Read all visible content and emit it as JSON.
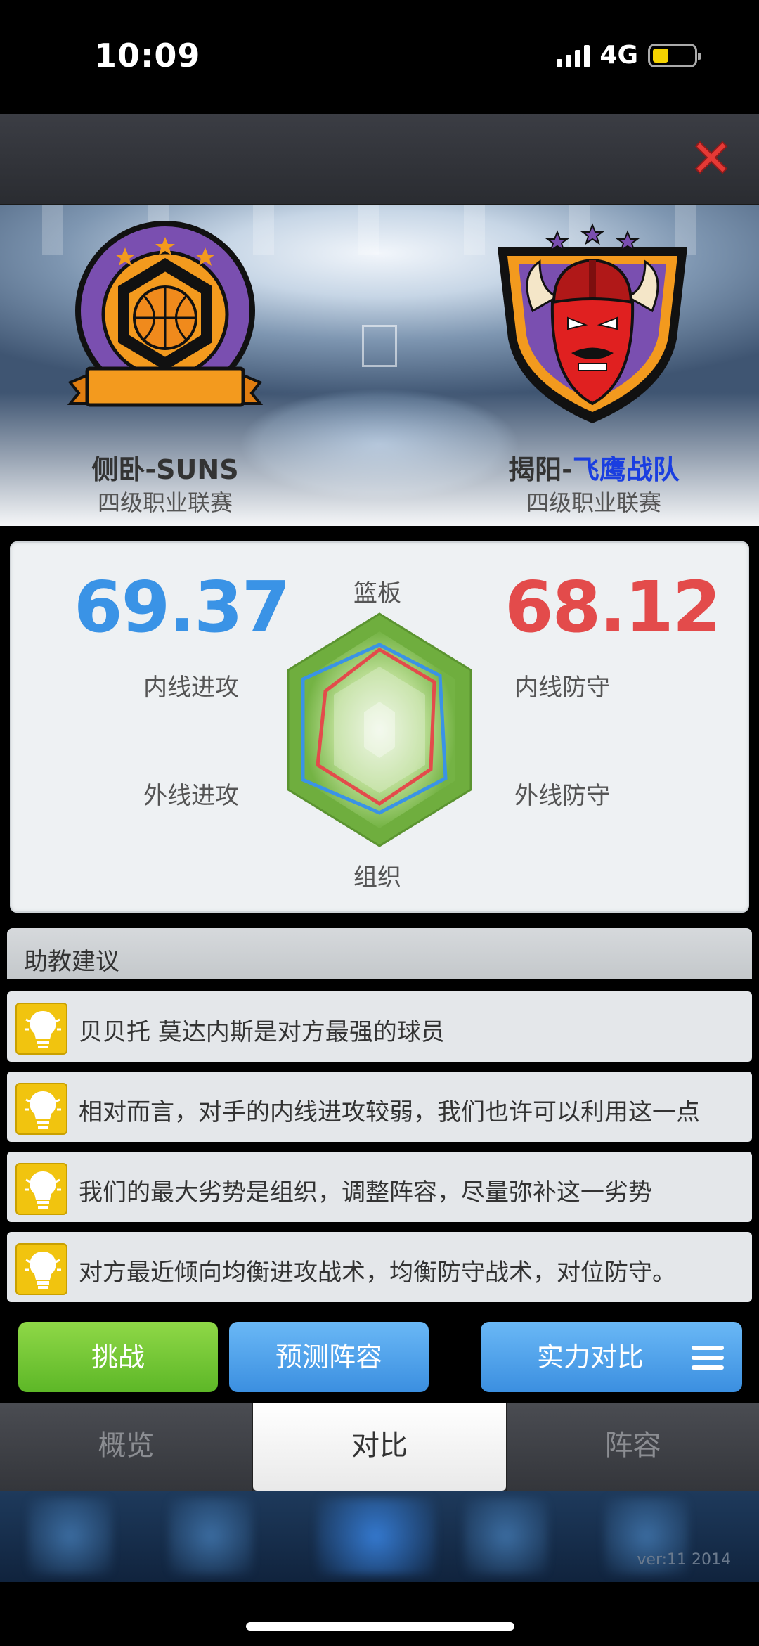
{
  "status_bar": {
    "time": "10:09",
    "network": "4G",
    "battery_color": "#f5d300"
  },
  "matchup": {
    "home": {
      "name": "侧卧-SUNS",
      "league": "四级职业联赛",
      "color": "#7a4fb0"
    },
    "away": {
      "name_prefix": "揭阳-",
      "name_highlight": "飞鹰战队",
      "league": "四级职业联赛",
      "color": "#e02020"
    }
  },
  "ratings": {
    "home_score": "69.37",
    "away_score": "68.12",
    "axes": {
      "top": "篮板",
      "upper_left": "内线进攻",
      "lower_left": "外线进攻",
      "upper_right": "内线防守",
      "lower_right": "外线防守",
      "bottom": "组织"
    },
    "home_color": "#3a93e6",
    "away_color": "#e34b4b"
  },
  "advice": {
    "title": "助教建议",
    "tips": [
      "贝贝托 莫达内斯是对方最强的球员",
      "相对而言，对手的内线进攻较弱，我们也许可以利用这一点",
      "我们的最大劣势是组织，调整阵容，尽量弥补这一劣势",
      "对方最近倾向均衡进攻战术，均衡防守战术，对位防守。"
    ]
  },
  "actions": {
    "challenge": "挑战",
    "predict_lineup": "预测阵容",
    "compare_strength": "实力对比"
  },
  "tabs": [
    "概览",
    "对比",
    "阵容"
  ],
  "active_tab": "对比",
  "version": "ver:11  2014"
}
